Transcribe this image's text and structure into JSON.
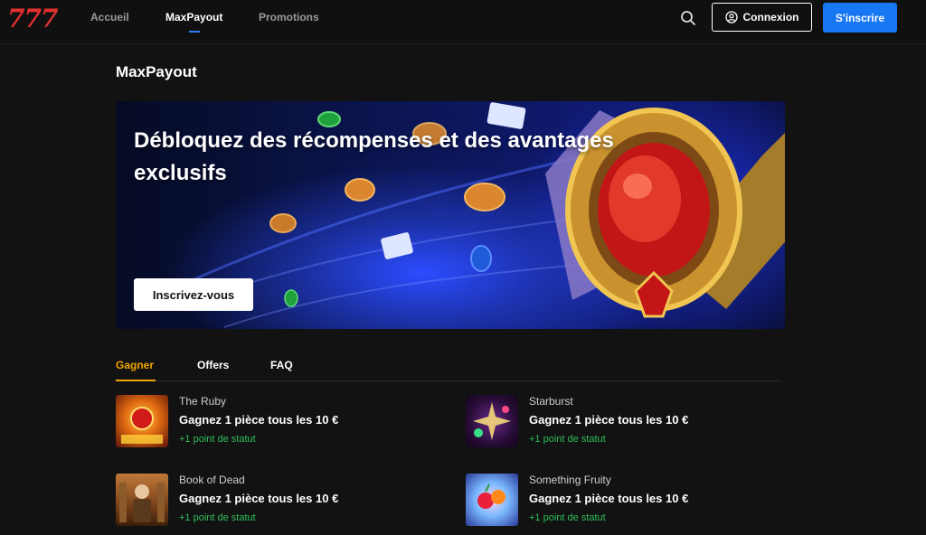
{
  "header": {
    "logo": "777",
    "nav": [
      {
        "label": "Accueil"
      },
      {
        "label": "MaxPayout"
      },
      {
        "label": "Promotions"
      }
    ],
    "search_icon": "search-icon",
    "login_label": "Connexion",
    "login_icon": "user-icon",
    "signup_label": "S'inscrire",
    "accent_color": "#1877f2"
  },
  "page": {
    "title": "MaxPayout"
  },
  "banner": {
    "title": "Débloquez des récompenses et des avantages exclusifs",
    "cta_label": "Inscrivez-vous"
  },
  "tabs": [
    {
      "label": "Gagner",
      "active": true,
      "color": "#f0a500"
    },
    {
      "label": "Offers",
      "active": false
    },
    {
      "label": "FAQ",
      "active": false
    }
  ],
  "games": [
    {
      "name": "The Ruby",
      "description": "Gagnez 1 pièce tous les 10 €",
      "status": "+1 point de statut"
    },
    {
      "name": "Starburst",
      "description": "Gagnez 1 pièce tous les 10 €",
      "status": "+1 point de statut"
    },
    {
      "name": "Book of Dead",
      "description": "Gagnez 1 pièce tous les 10 €",
      "status": "+1 point de statut"
    },
    {
      "name": "Something Fruity",
      "description": "Gagnez 1 pièce tous les 10 €",
      "status": "+1 point de statut"
    }
  ],
  "status_color": "#2fbf5a"
}
